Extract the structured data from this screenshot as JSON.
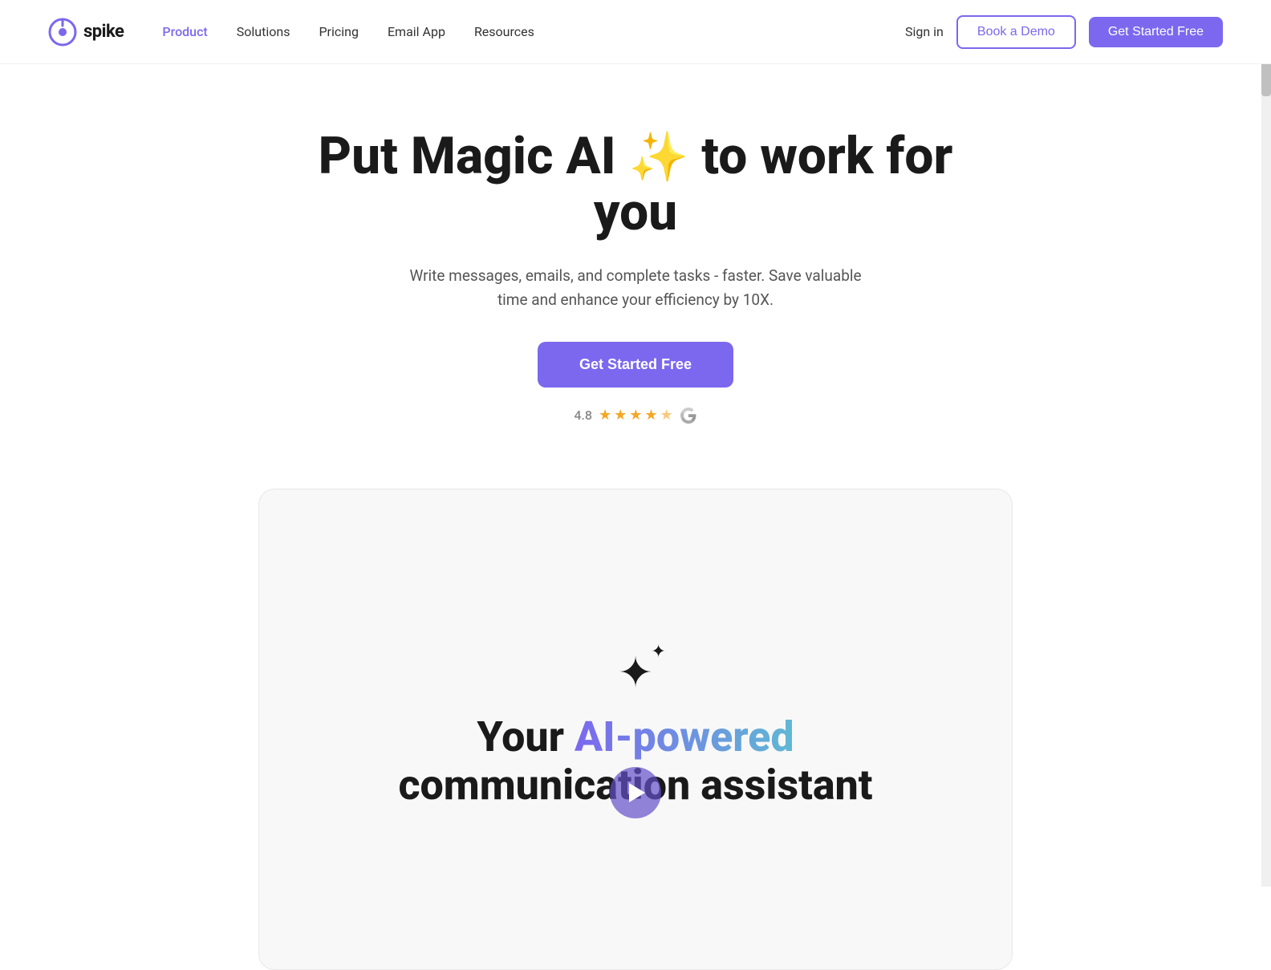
{
  "brand": {
    "logo_text": "spike",
    "logo_icon_alt": "spike-logo"
  },
  "navbar": {
    "links": [
      {
        "label": "Product",
        "active": true,
        "id": "product"
      },
      {
        "label": "Solutions",
        "active": false,
        "id": "solutions"
      },
      {
        "label": "Pricing",
        "active": false,
        "id": "pricing"
      },
      {
        "label": "Email App",
        "active": false,
        "id": "email-app"
      },
      {
        "label": "Resources",
        "active": false,
        "id": "resources"
      }
    ],
    "sign_in": "Sign in",
    "book_demo": "Book a Demo",
    "get_started": "Get Started Free"
  },
  "hero": {
    "title_before": "Put Magic AI",
    "title_sparkle": "✦",
    "title_after": "to work for you",
    "subtitle": "Write messages, emails, and complete tasks - faster. Save valuable time and enhance your efficiency by 10X.",
    "cta_button": "Get Started Free",
    "rating": {
      "score": "4.8",
      "stars_filled": 4,
      "stars_half": 1,
      "stars_empty": 0,
      "platform": "G"
    }
  },
  "video_section": {
    "sparkle_main": "✦",
    "sparkle_small": "✦",
    "title_before": "Your ",
    "title_gradient": "AI-powered",
    "title_after": "communication assistant"
  },
  "colors": {
    "brand_purple": "#7b68ee",
    "brand_dark": "#1a1a1a",
    "text_muted": "#888888",
    "star_color": "#f5a623"
  }
}
